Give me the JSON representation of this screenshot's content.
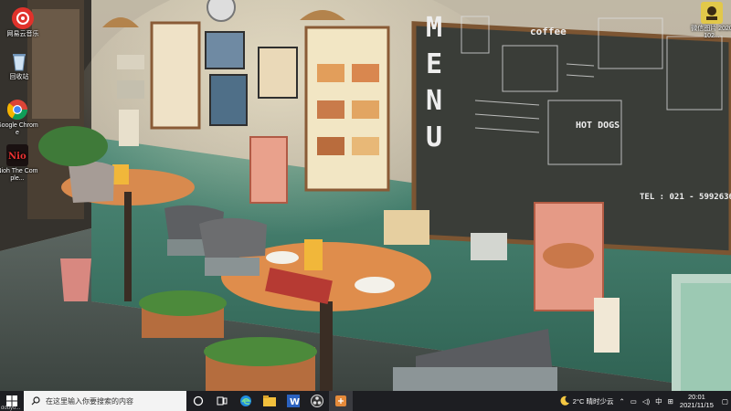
{
  "desktop_icons": [
    {
      "name": "netease-music",
      "label": "网易云音乐",
      "icon": "music-note-icon",
      "color": "#e0322b"
    },
    {
      "name": "recycle-bin",
      "label": "回收站",
      "icon": "recycle-bin-icon",
      "color": "#9fc6e8"
    },
    {
      "name": "chrome",
      "label": "Google Chrome",
      "icon": "chrome-icon",
      "color": "#e8a33a"
    },
    {
      "name": "nioh",
      "label": "Nioh The Comple...",
      "icon": "game-icon",
      "color": "#7a1010"
    },
    {
      "name": "image-file",
      "label": "微信图片 2020102...",
      "icon": "image-file-icon",
      "color": "#e2c84a"
    }
  ],
  "wallpaper": {
    "menu_board": {
      "title": "MENU",
      "coffee": "coffee",
      "hot_dogs": "HOT DOGS",
      "phone": "TEL : 021 - 59926369"
    }
  },
  "taskbar": {
    "search_placeholder": "在这里输入你要搜索的内容",
    "apps": [
      "task-view-icon",
      "edge-icon",
      "file-explorer-icon",
      "word-icon",
      "obs-icon",
      "package-icon"
    ],
    "weather": "2°C 晴时少云",
    "tray_keyboard": "中",
    "time": "20:01",
    "date": "2021/11/15",
    "watermark": "douyu..."
  },
  "colors": {
    "taskbar": "#1d1e22",
    "accent": "#e8348b"
  }
}
